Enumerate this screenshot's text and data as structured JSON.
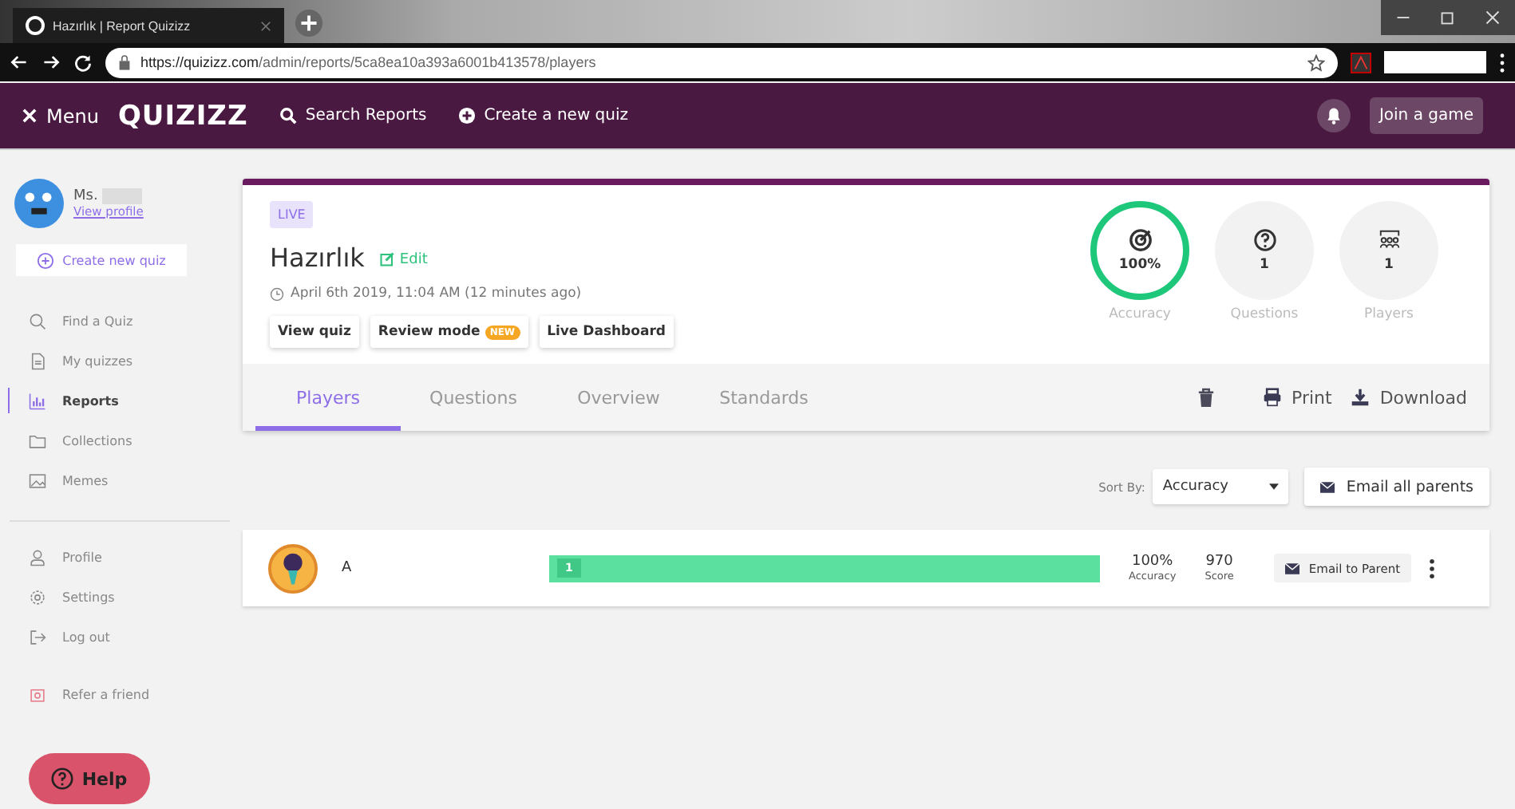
{
  "browser": {
    "tab_title": "Hazırlık | Report Quizizz",
    "url_domain": "https://quizizz.com",
    "url_path": "/admin/reports/5ca8ea10a393a6001b413578/players"
  },
  "header": {
    "menu_label": "Menu",
    "logo": "QUIZIZZ",
    "links": [
      {
        "kind": "search",
        "label": "Search Reports"
      },
      {
        "kind": "create",
        "label": "Create a new quiz"
      }
    ],
    "join_button": "Join a game"
  },
  "sidebar": {
    "user": {
      "name": "Ms.",
      "profile_link": "View profile"
    },
    "create_button": "Create new quiz",
    "items": [
      {
        "kind": "search",
        "label": "Find a Quiz",
        "selected": false
      },
      {
        "kind": "doc",
        "label": "My quizzes",
        "selected": false
      },
      {
        "kind": "chart",
        "label": "Reports",
        "selected": true
      },
      {
        "kind": "folder",
        "label": "Collections",
        "selected": false
      },
      {
        "kind": "image",
        "label": "Memes",
        "selected": false
      }
    ],
    "account_items": [
      {
        "kind": "user",
        "label": "Profile"
      },
      {
        "kind": "gear",
        "label": "Settings"
      },
      {
        "kind": "logout",
        "label": "Log out"
      }
    ],
    "refer": "Refer a friend",
    "help_button": "Help"
  },
  "report": {
    "status": "LIVE",
    "title": "Hazırlık",
    "edit": "Edit",
    "date": "April 6th 2019, 11:04 AM (12 minutes ago)",
    "buttons": [
      {
        "label": "View quiz"
      },
      {
        "label": "Review mode",
        "badge": "NEW"
      },
      {
        "label": "Live Dashboard"
      }
    ],
    "stats": [
      {
        "kind": "accuracy",
        "value": "100%",
        "label": "Accuracy",
        "highlighted": true
      },
      {
        "kind": "questions",
        "value": "1",
        "label": "Questions",
        "highlighted": false
      },
      {
        "kind": "players",
        "value": "1",
        "label": "Players",
        "highlighted": false
      }
    ],
    "tabs": [
      {
        "label": "Players",
        "selected": true
      },
      {
        "label": "Questions",
        "selected": false
      },
      {
        "label": "Overview",
        "selected": false
      },
      {
        "label": "Standards",
        "selected": false
      }
    ],
    "actions": [
      {
        "kind": "delete"
      },
      {
        "kind": "print",
        "label": "Print"
      },
      {
        "kind": "download",
        "label": "Download"
      }
    ]
  },
  "sort": {
    "label": "Sort By:",
    "value": "Accuracy"
  },
  "email_all": "Email all parents",
  "players": [
    {
      "name": "A",
      "level": 1,
      "bar_label": "1",
      "accuracy": "100%",
      "accuracy_label": "Accuracy",
      "score": "970",
      "score_label": "Score",
      "email_button": "Email to Parent"
    }
  ]
}
